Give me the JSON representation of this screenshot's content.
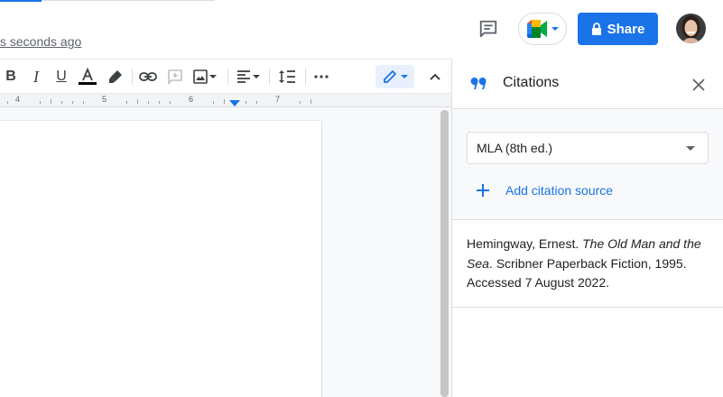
{
  "header": {
    "last_edit": "s seconds ago",
    "share_label": "Share"
  },
  "ruler": {
    "numbers": [
      "4",
      "5",
      "6",
      "7"
    ]
  },
  "citations_panel": {
    "title": "Citations",
    "style_selected": "MLA (8th ed.)",
    "add_source_label": "Add citation source",
    "citation": {
      "author": "Hemingway, Ernest.",
      "title": "The Old Man and the Sea",
      "publisher": ". Scribner Paperback Fiction, 1995. Accessed 7 August 2022."
    }
  },
  "colors": {
    "accent": "#1a73e8",
    "meet_green": "#00832d",
    "meet_yellow": "#ffba00",
    "meet_red": "#ea4335",
    "meet_blue": "#2684fc"
  }
}
